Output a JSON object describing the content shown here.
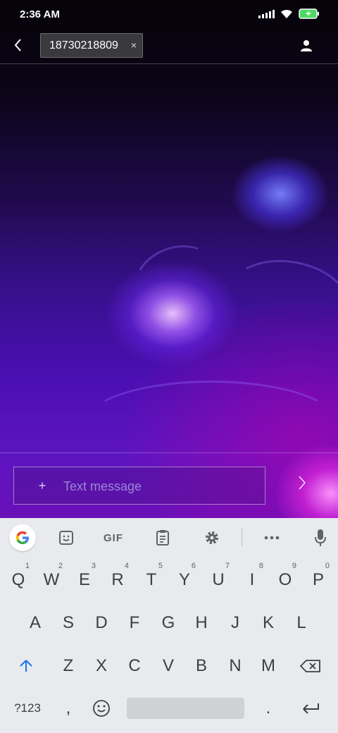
{
  "status_bar": {
    "time": "2:36 AM",
    "icons": [
      "signal-icon",
      "wifi-icon",
      "battery-charging-icon"
    ]
  },
  "top_bar": {
    "back_icon": "chevron-left-icon",
    "recipient": "18730218809",
    "recipient_remove": "×",
    "contact_icon": "person-icon"
  },
  "compose": {
    "attach_label": "+",
    "placeholder": "Text message",
    "send_icon": "chevron-right-icon"
  },
  "keyboard": {
    "toolbar": [
      "google-icon",
      "sticker-icon",
      "GIF",
      "clipboard-icon",
      "gear-icon",
      "more-icon",
      "mic-icon"
    ],
    "gif_label": "GIF",
    "row1": [
      {
        "label": "Q",
        "hint": "1"
      },
      {
        "label": "W",
        "hint": "2"
      },
      {
        "label": "E",
        "hint": "3"
      },
      {
        "label": "R",
        "hint": "4"
      },
      {
        "label": "T",
        "hint": "5"
      },
      {
        "label": "Y",
        "hint": "6"
      },
      {
        "label": "U",
        "hint": "7"
      },
      {
        "label": "I",
        "hint": "8"
      },
      {
        "label": "O",
        "hint": "9"
      },
      {
        "label": "P",
        "hint": "0"
      }
    ],
    "row2": [
      "A",
      "S",
      "D",
      "F",
      "G",
      "H",
      "J",
      "K",
      "L"
    ],
    "row3": [
      "Z",
      "X",
      "C",
      "V",
      "B",
      "N",
      "M"
    ],
    "row4": {
      "symbols": "?123",
      "comma": ",",
      "emoji_icon": "emoji-icon",
      "period": ".",
      "enter_icon": "enter-icon"
    },
    "accent_color": "#1a73e8"
  }
}
